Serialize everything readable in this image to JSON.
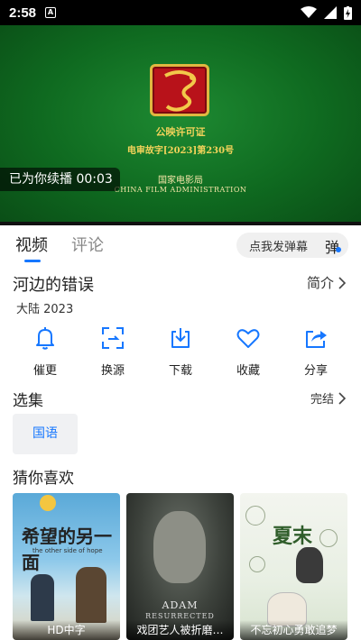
{
  "status_bar": {
    "time": "2:58",
    "notification_letter": "A"
  },
  "video": {
    "license_title": "公映许可证",
    "license_number": "电审故字[2023]第230号",
    "bureau_cn": "国家电影局",
    "bureau_en": "CHINA FILM ADMINISTRATION",
    "resume_text": "已为你续播 00:03"
  },
  "tabs": [
    {
      "label": "视频",
      "active": true
    },
    {
      "label": "评论",
      "active": false
    }
  ],
  "danmu": {
    "placeholder": "点我发弹幕",
    "button": "弹"
  },
  "movie": {
    "title": "河边的错误",
    "intro_label": "简介",
    "meta": "大陆 2023"
  },
  "actions": [
    {
      "label": "催更",
      "icon": "bell-icon"
    },
    {
      "label": "换源",
      "icon": "switch-source-icon"
    },
    {
      "label": "下载",
      "icon": "download-icon"
    },
    {
      "label": "收藏",
      "icon": "heart-icon"
    },
    {
      "label": "分享",
      "icon": "share-icon"
    }
  ],
  "episodes": {
    "title": "选集",
    "status": "完结",
    "items": [
      "国语"
    ]
  },
  "recommend": {
    "title": "猜你喜欢",
    "items": [
      {
        "caption": "HD中字",
        "poster_title": "希望的另一面",
        "poster_sub": "the other side of hope"
      },
      {
        "caption": "戏团艺人被折磨…",
        "poster_title": "ADAM",
        "poster_title2": "RESURRECTED"
      },
      {
        "caption": "不忘初心勇敢追梦",
        "poster_title": "夏末"
      }
    ]
  },
  "colors": {
    "accent": "#1677ff",
    "video_green": "#0f6a20",
    "gold": "#f2d35a"
  }
}
